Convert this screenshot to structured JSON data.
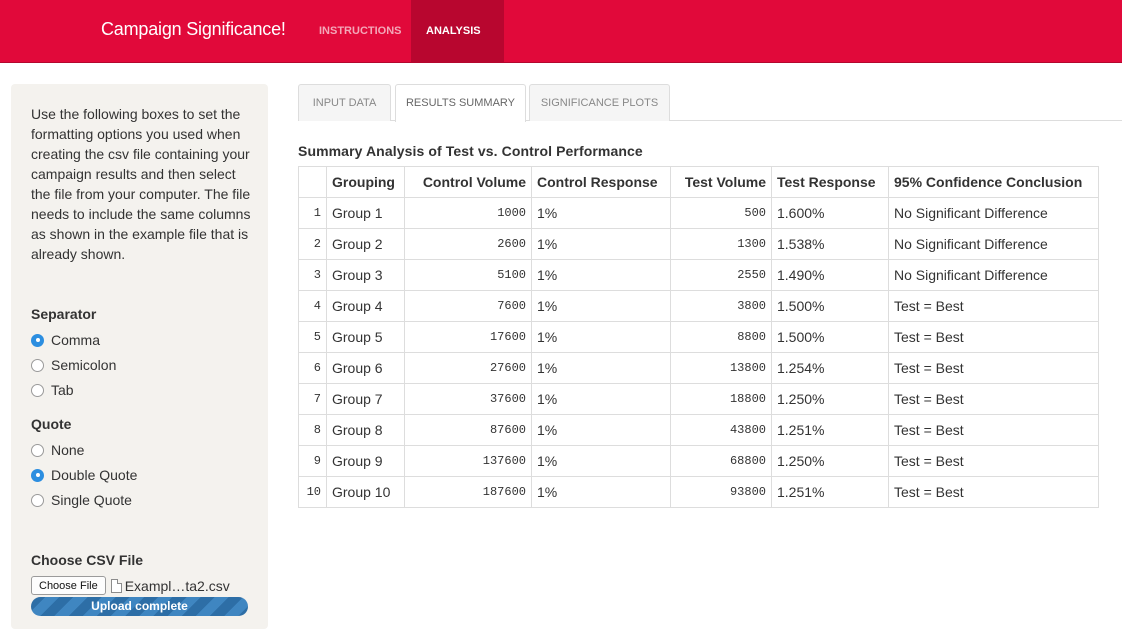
{
  "navbar": {
    "brand": "Campaign Significance!",
    "items": [
      {
        "label": "INSTRUCTIONS"
      },
      {
        "label": "ANALYSIS"
      }
    ]
  },
  "sidebar": {
    "intro": "Use the following boxes to set the formatting options you used when creating the csv file containing your campaign results and then select the file from your computer. The file needs to include the same columns as shown in the example file that is already shown.",
    "separator": {
      "label": "Separator",
      "options": [
        {
          "label": "Comma",
          "checked": true
        },
        {
          "label": "Semicolon",
          "checked": false
        },
        {
          "label": "Tab",
          "checked": false
        }
      ]
    },
    "quote": {
      "label": "Quote",
      "options": [
        {
          "label": "None",
          "checked": false
        },
        {
          "label": "Double Quote",
          "checked": true
        },
        {
          "label": "Single Quote",
          "checked": false
        }
      ]
    },
    "file": {
      "label": "Choose CSV File",
      "button": "Choose File",
      "filename": "Exampl…ta2.csv",
      "progress_text": "Upload complete",
      "progress_fraction": 1.0
    }
  },
  "tabs": [
    {
      "label": "INPUT DATA",
      "active": false
    },
    {
      "label": "RESULTS SUMMARY",
      "active": true
    },
    {
      "label": "SIGNIFICANCE PLOTS",
      "active": false
    }
  ],
  "summary": {
    "title": "Summary Analysis of Test vs. Control Performance",
    "columns": [
      "",
      "Grouping",
      "Control Volume",
      "Control Response",
      "Test Volume",
      "Test Response",
      "95% Confidence Conclusion"
    ],
    "rows": [
      [
        "1",
        "Group 1",
        "1000",
        "1%",
        "500",
        "1.600%",
        "No Significant Difference"
      ],
      [
        "2",
        "Group 2",
        "2600",
        "1%",
        "1300",
        "1.538%",
        "No Significant Difference"
      ],
      [
        "3",
        "Group 3",
        "5100",
        "1%",
        "2550",
        "1.490%",
        "No Significant Difference"
      ],
      [
        "4",
        "Group 4",
        "7600",
        "1%",
        "3800",
        "1.500%",
        "Test = Best"
      ],
      [
        "5",
        "Group 5",
        "17600",
        "1%",
        "8800",
        "1.500%",
        "Test = Best"
      ],
      [
        "6",
        "Group 6",
        "27600",
        "1%",
        "13800",
        "1.254%",
        "Test = Best"
      ],
      [
        "7",
        "Group 7",
        "37600",
        "1%",
        "18800",
        "1.250%",
        "Test = Best"
      ],
      [
        "8",
        "Group 8",
        "87600",
        "1%",
        "43800",
        "1.251%",
        "Test = Best"
      ],
      [
        "9",
        "Group 9",
        "137600",
        "1%",
        "68800",
        "1.250%",
        "Test = Best"
      ],
      [
        "10",
        "Group 10",
        "187600",
        "1%",
        "93800",
        "1.251%",
        "Test = Best"
      ]
    ]
  },
  "colors": {
    "navbar": "#e1093a",
    "navbar_active": "#b8062f",
    "sidebar_bg": "#f4f2ee",
    "radio_checked": "#2c8ee0",
    "progress": "#2d6ea6"
  }
}
